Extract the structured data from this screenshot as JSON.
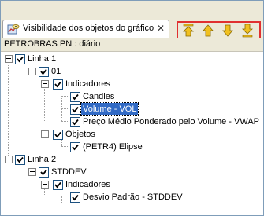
{
  "window": {
    "tab_title": "Visibilidade dos objetos do gráfico",
    "close_glyph": "✕",
    "tab_icon": "chart-visibility-icon"
  },
  "toolbar": {
    "buttons": [
      {
        "name": "move-to-top",
        "icon": "arrow-up-top-icon"
      },
      {
        "name": "move-up",
        "icon": "arrow-up-icon"
      },
      {
        "name": "move-down",
        "icon": "arrow-down-icon"
      },
      {
        "name": "move-to-bottom",
        "icon": "arrow-down-bottom-icon"
      }
    ],
    "highlight_color": "#e03030"
  },
  "subheader": {
    "text": "PETROBRAS PN : diário"
  },
  "tree": {
    "linha1": "Linha 1",
    "n01": "01",
    "indicadores1": "Indicadores",
    "candles": "Candles",
    "volume": "Volume - VOL",
    "vwap": "Preço Médio Ponderado pelo Volume - VWAP",
    "objetos": "Objetos",
    "elipse": "(PETR4) Elipse",
    "linha2": "Linha 2",
    "stddev": "STDDEV",
    "indicadores2": "Indicadores",
    "desvio": "Desvio Padrão - STDDEV"
  },
  "colors": {
    "selection": "#316ac5",
    "arrow": "#f0c020"
  }
}
